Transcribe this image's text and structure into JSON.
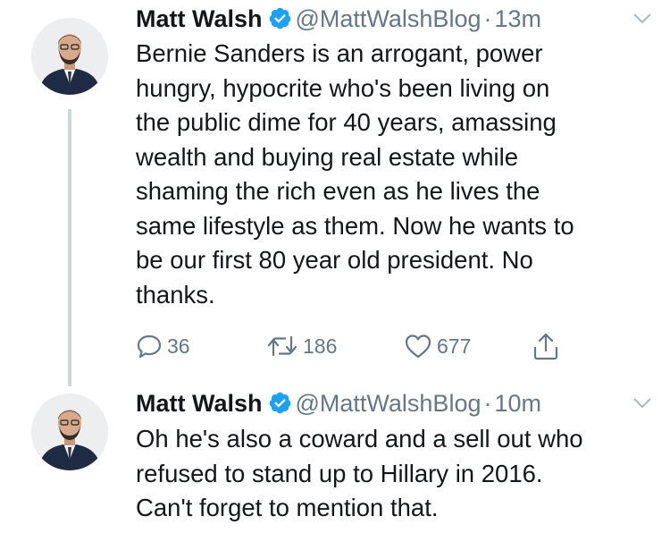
{
  "tweets": [
    {
      "author": {
        "name": "Matt Walsh",
        "handle": "@MattWalshBlog",
        "verified": true
      },
      "separator": "·",
      "time": "13m",
      "text_lines": [
        "Bernie Sanders is an arrogant, power",
        "hungry, hypocrite who's been living on",
        "the public dime for 40 years, amassing",
        "wealth and buying real estate while",
        "shaming the rich even as he lives the",
        "same lifestyle as them. Now he wants to",
        "be our first 80 year old president. No",
        "thanks."
      ],
      "actions": {
        "reply_count": "36",
        "retweet_count": "186",
        "like_count": "677"
      }
    },
    {
      "author": {
        "name": "Matt Walsh",
        "handle": "@MattWalshBlog",
        "verified": true
      },
      "separator": "·",
      "time": "10m",
      "text_lines": [
        "Oh he's also a coward and a sell out who",
        "refused to stand up to Hillary in 2016.",
        "Can't forget to mention that."
      ]
    }
  ],
  "icons": {
    "verified": "verified-badge-icon",
    "menu": "chevron-down-icon",
    "reply": "reply-icon",
    "retweet": "retweet-icon",
    "like": "heart-icon",
    "share": "share-icon"
  },
  "colors": {
    "verified_blue": "#1da1f2",
    "text": "#14171a",
    "secondary": "#657786",
    "thread_line": "#ccd6dd"
  }
}
